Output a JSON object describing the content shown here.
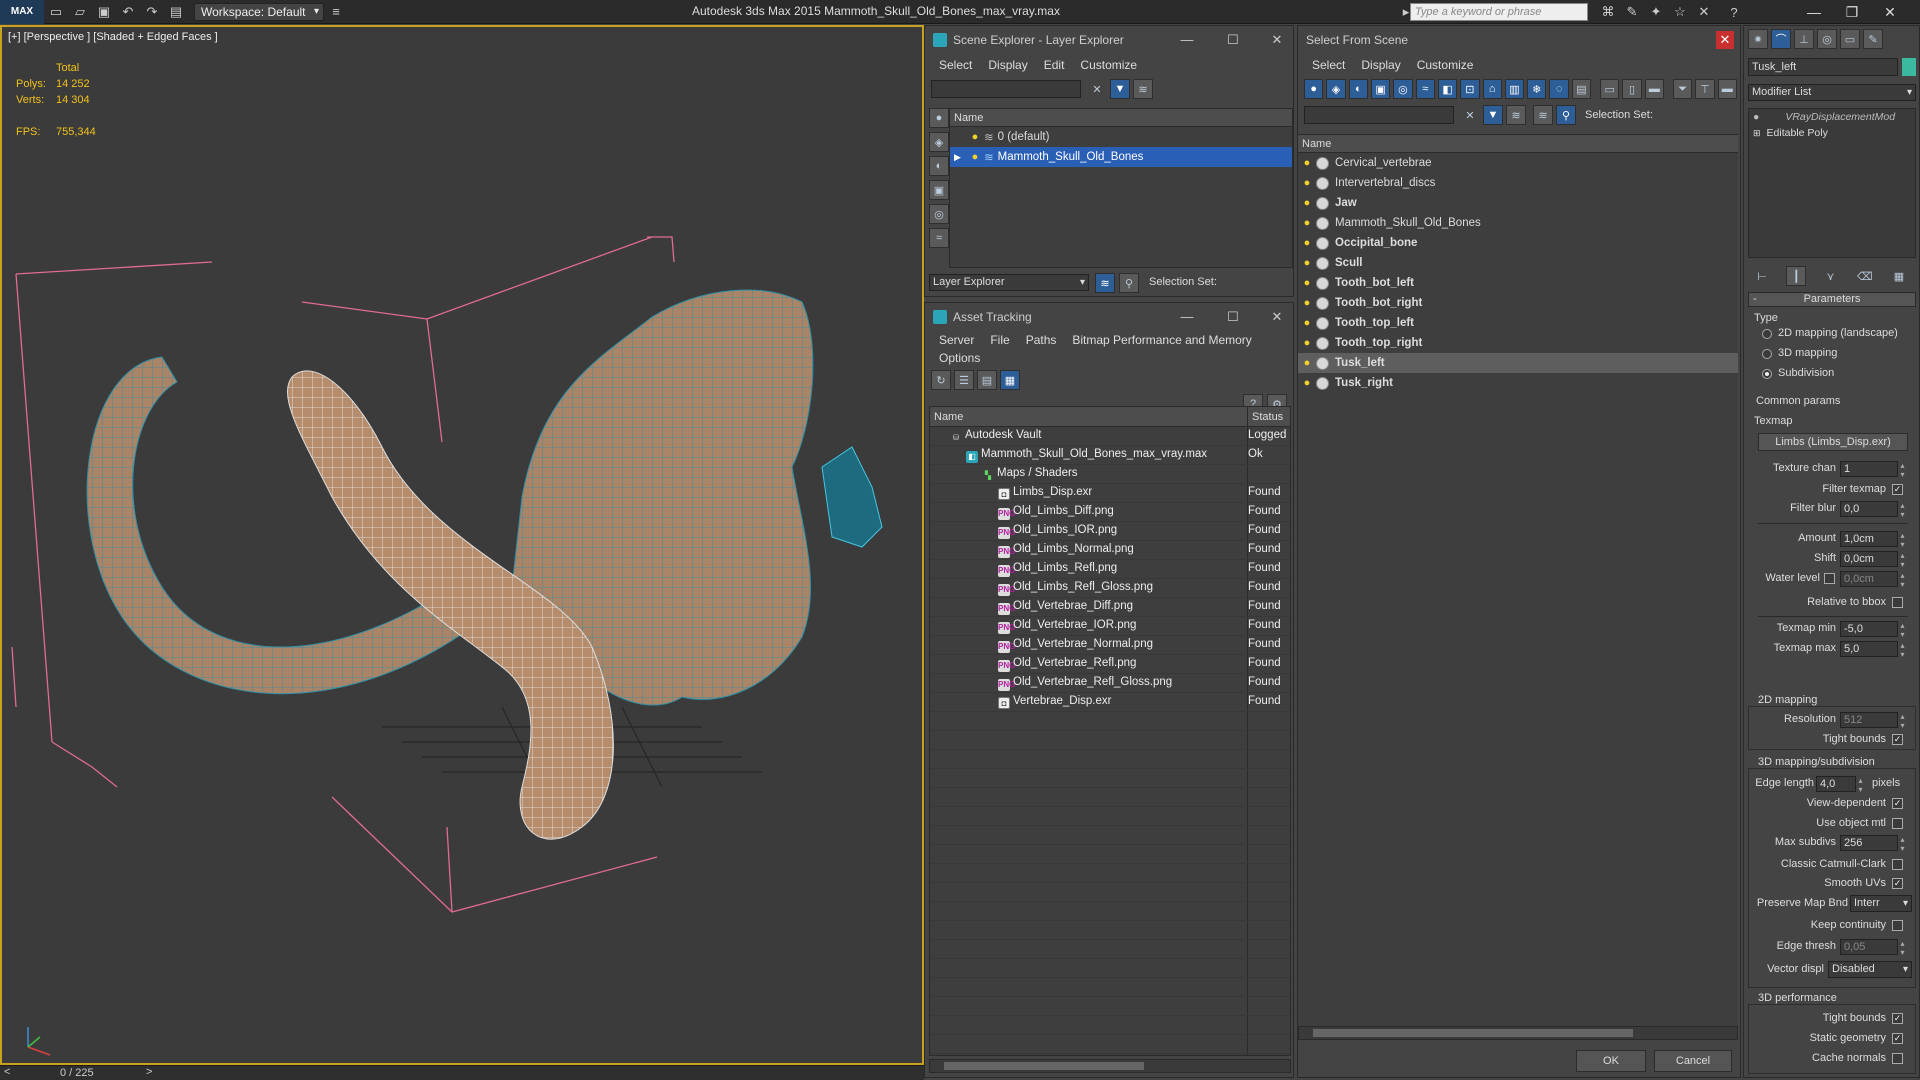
{
  "titlebar": {
    "workspace": "Workspace: Default",
    "app_title": "Autodesk 3ds Max  2015    Mammoth_Skull_Old_Bones_max_vray.max",
    "search_placeholder": "Type a keyword or phrase"
  },
  "viewport": {
    "label": "[+] [Perspective ] [Shaded + Edged Faces ]",
    "stats": {
      "total_label": "Total",
      "polys_label": "Polys:",
      "polys_value": "14 252",
      "verts_label": "Verts:",
      "verts_value": "14 304",
      "fps_label": "FPS:",
      "fps_value": "755,344"
    },
    "time_slider": "0 / 225"
  },
  "scene_explorer": {
    "title": "Scene Explorer - Layer Explorer",
    "menu": [
      "Select",
      "Display",
      "Edit",
      "Customize"
    ],
    "col_name": "Name",
    "layers": [
      {
        "name": "0 (default)",
        "selected": false
      },
      {
        "name": "Mammoth_Skull_Old_Bones",
        "selected": true
      }
    ],
    "footer_combo": "Layer Explorer",
    "selection_set_label": "Selection Set:"
  },
  "asset_tracking": {
    "title": "Asset Tracking",
    "menu_row1": [
      "Server",
      "File",
      "Paths",
      "Bitmap Performance and Memory"
    ],
    "menu_row2": [
      "Options"
    ],
    "col_name": "Name",
    "col_status": "Status",
    "rows": [
      {
        "name": "Autodesk Vault",
        "status": "Logged",
        "indent": 1,
        "icon": "vault"
      },
      {
        "name": "Mammoth_Skull_Old_Bones_max_vray.max",
        "status": "Ok",
        "indent": 2,
        "icon": "max"
      },
      {
        "name": "Maps / Shaders",
        "status": "",
        "indent": 3,
        "icon": "maps"
      },
      {
        "name": "Limbs_Disp.exr",
        "status": "Found",
        "indent": 4,
        "icon": "exr"
      },
      {
        "name": "Old_Limbs_Diff.png",
        "status": "Found",
        "indent": 4,
        "icon": "png"
      },
      {
        "name": "Old_Limbs_IOR.png",
        "status": "Found",
        "indent": 4,
        "icon": "png"
      },
      {
        "name": "Old_Limbs_Normal.png",
        "status": "Found",
        "indent": 4,
        "icon": "png"
      },
      {
        "name": "Old_Limbs_Refl.png",
        "status": "Found",
        "indent": 4,
        "icon": "png"
      },
      {
        "name": "Old_Limbs_Refl_Gloss.png",
        "status": "Found",
        "indent": 4,
        "icon": "png"
      },
      {
        "name": "Old_Vertebrae_Diff.png",
        "status": "Found",
        "indent": 4,
        "icon": "png"
      },
      {
        "name": "Old_Vertebrae_IOR.png",
        "status": "Found",
        "indent": 4,
        "icon": "png"
      },
      {
        "name": "Old_Vertebrae_Normal.png",
        "status": "Found",
        "indent": 4,
        "icon": "png"
      },
      {
        "name": "Old_Vertebrae_Refl.png",
        "status": "Found",
        "indent": 4,
        "icon": "png"
      },
      {
        "name": "Old_Vertebrae_Refl_Gloss.png",
        "status": "Found",
        "indent": 4,
        "icon": "png"
      },
      {
        "name": "Vertebrae_Disp.exr",
        "status": "Found",
        "indent": 4,
        "icon": "exr"
      }
    ]
  },
  "select_from_scene": {
    "title": "Select From Scene",
    "menu": [
      "Select",
      "Display",
      "Customize"
    ],
    "selection_set_label": "Selection Set:",
    "col_name": "Name",
    "objects": [
      {
        "name": "Cervical_vertebrae",
        "bold": false,
        "highlight": false
      },
      {
        "name": "Intervertebral_discs",
        "bold": false,
        "highlight": false
      },
      {
        "name": "Jaw",
        "bold": true,
        "highlight": false
      },
      {
        "name": "Mammoth_Skull_Old_Bones",
        "bold": false,
        "highlight": false
      },
      {
        "name": "Occipital_bone",
        "bold": true,
        "highlight": false
      },
      {
        "name": "Scull",
        "bold": true,
        "highlight": false
      },
      {
        "name": "Tooth_bot_left",
        "bold": true,
        "highlight": false
      },
      {
        "name": "Tooth_bot_right",
        "bold": true,
        "highlight": false
      },
      {
        "name": "Tooth_top_left",
        "bold": true,
        "highlight": false
      },
      {
        "name": "Tooth_top_right",
        "bold": true,
        "highlight": false
      },
      {
        "name": "Tusk_left",
        "bold": true,
        "highlight": true
      },
      {
        "name": "Tusk_right",
        "bold": true,
        "highlight": false
      }
    ],
    "ok_label": "OK",
    "cancel_label": "Cancel"
  },
  "command_panel": {
    "object_name": "Tusk_left",
    "modifier_list": "Modifier List",
    "stack": [
      "VRayDisplacementMod",
      "Editable Poly"
    ],
    "rollout_title": "Parameters",
    "type_label": "Type",
    "type_options": [
      "2D mapping (landscape)",
      "3D mapping",
      "Subdivision"
    ],
    "type_selected": 2,
    "common_params": "Common params",
    "texmap_label": "Texmap",
    "texmap_button": "Limbs (Limbs_Disp.exr)",
    "texture_chan_label": "Texture chan",
    "texture_chan_value": "1",
    "filter_texmap_label": "Filter texmap",
    "filter_blur_label": "Filter blur",
    "filter_blur_value": "0,0",
    "amount_label": "Amount",
    "amount_value": "1,0cm",
    "shift_label": "Shift",
    "shift_value": "0,0cm",
    "water_level_label": "Water level",
    "water_level_value": "0,0cm",
    "relative_bbox_label": "Relative to bbox",
    "texmap_min_label": "Texmap min",
    "texmap_min_value": "-5,0",
    "texmap_max_label": "Texmap max",
    "texmap_max_value": "5,0",
    "mapping2d_title": "2D mapping",
    "resolution_label": "Resolution",
    "resolution_value": "512",
    "tight_bounds_label": "Tight bounds",
    "mapping3d_title": "3D mapping/subdivision",
    "edge_length_label": "Edge length",
    "edge_length_value": "4,0",
    "pixels_label": "pixels",
    "view_dependent_label": "View-dependent",
    "use_object_mtl_label": "Use object mtl",
    "max_subdivs_label": "Max subdivs",
    "max_subdivs_value": "256",
    "classic_cc_label": "Classic Catmull-Clark",
    "smooth_uvs_label": "Smooth UVs",
    "preserve_map_label": "Preserve Map Bnd",
    "preserve_map_value": "Interr",
    "keep_continuity_label": "Keep continuity",
    "edge_thresh_label": "Edge thresh",
    "edge_thresh_value": "0,05",
    "vector_displ_label": "Vector displ",
    "vector_displ_value": "Disabled",
    "perf_title": "3D performance",
    "perf_tight_bounds_label": "Tight bounds",
    "static_geometry_label": "Static geometry",
    "cache_normals_label": "Cache normals"
  }
}
